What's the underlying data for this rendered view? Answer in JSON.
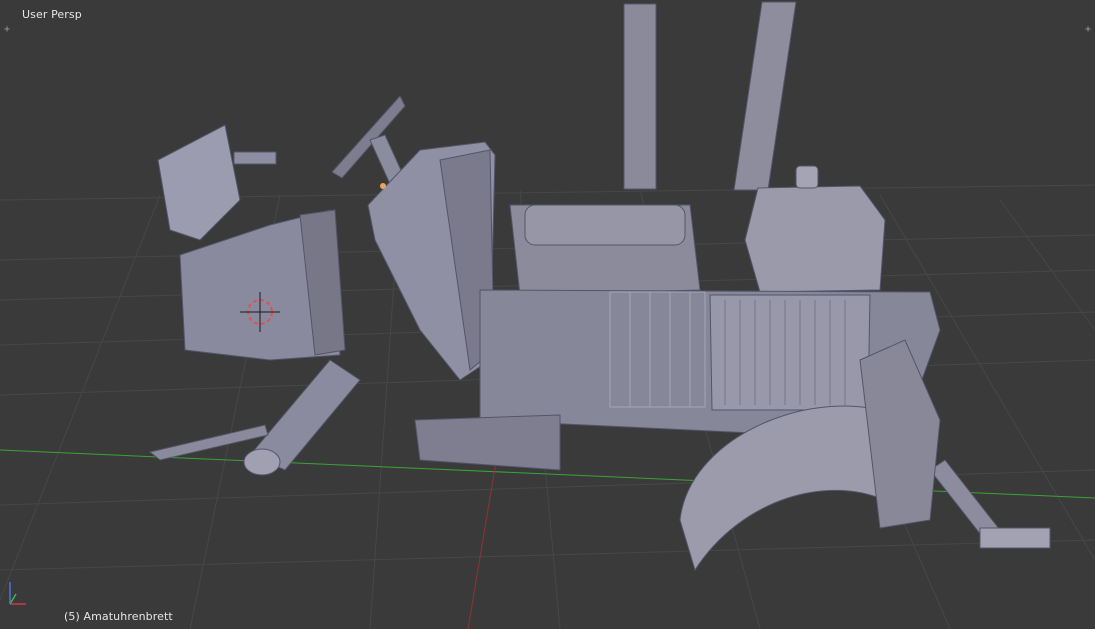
{
  "viewport": {
    "view_label": "User Persp",
    "object_label": "(5) Amatuhrenbrett",
    "colors": {
      "background": "#393939",
      "grid": "#4a4a4a",
      "x_axis": "#3ba235",
      "y_axis": "#8d3434",
      "mesh": "#8f8fa0",
      "mesh_light": "#b5b5c4",
      "mesh_dark": "#5f5f6e"
    },
    "icons": {
      "corner_left": "plus-icon",
      "corner_right": "plus-icon",
      "cursor": "3d-cursor-icon",
      "axes": "axis-gizmo-icon"
    }
  }
}
